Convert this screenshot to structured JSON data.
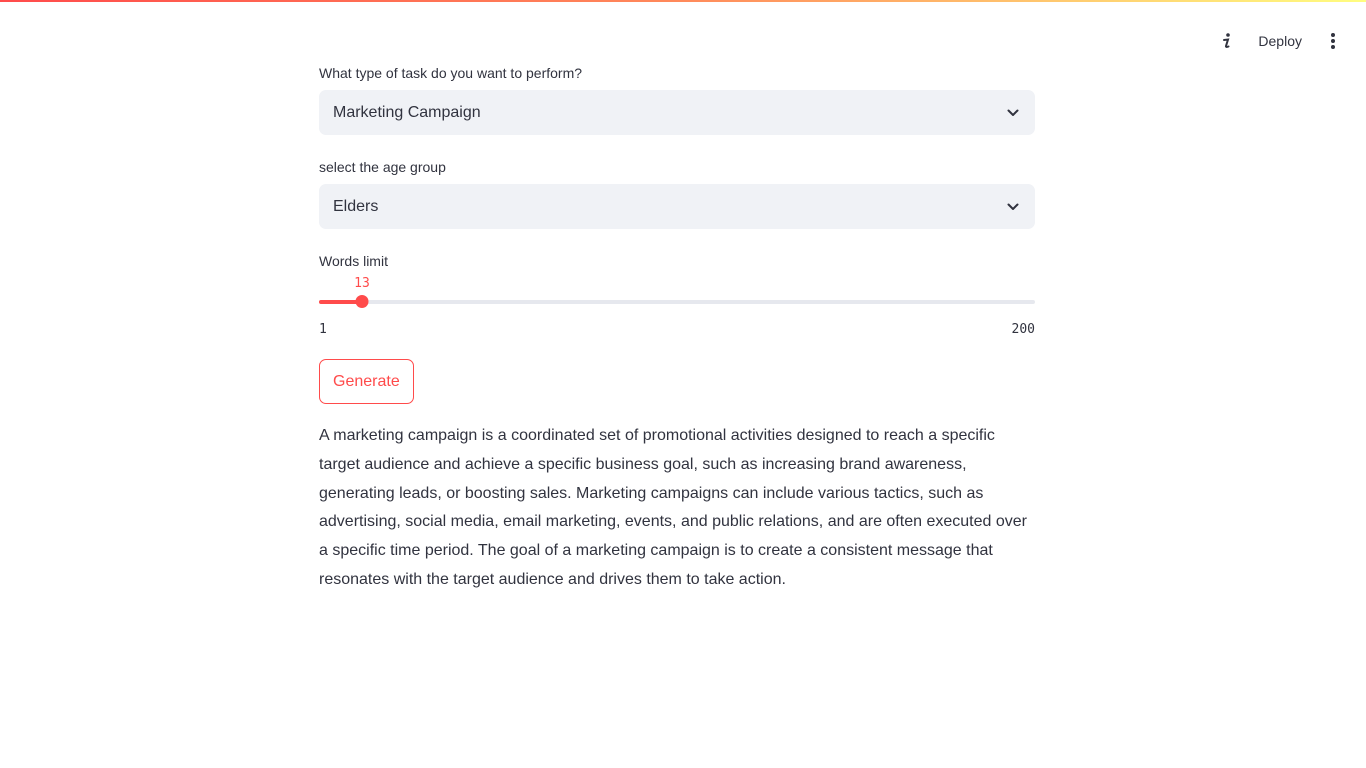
{
  "toolbar": {
    "info_icon": "info-icon",
    "deploy_label": "Deploy",
    "menu_icon": "kebab-menu-icon"
  },
  "task_select": {
    "label": "What type of task do you want to perform?",
    "value": "Marketing Campaign"
  },
  "age_select": {
    "label": "select the age group",
    "value": "Elders"
  },
  "words_slider": {
    "label": "Words limit",
    "value": 13,
    "value_text": "13",
    "min": 1,
    "max": 200,
    "min_text": "1",
    "max_text": "200"
  },
  "generate_button": {
    "label": "Generate"
  },
  "output": {
    "text": "A marketing campaign is a coordinated set of promotional activities designed to reach a specific target audience and achieve a specific business goal, such as increasing brand awareness, generating leads, or boosting sales. Marketing campaigns can include various tactics, such as advertising, social media, email marketing, events, and public relations, and are often executed over a specific time period. The goal of a marketing campaign is to create a consistent message that resonates with the target audience and drives them to take action."
  },
  "colors": {
    "accent": "#ff4b4b",
    "select_bg": "#f0f2f6",
    "text": "#31333f"
  }
}
